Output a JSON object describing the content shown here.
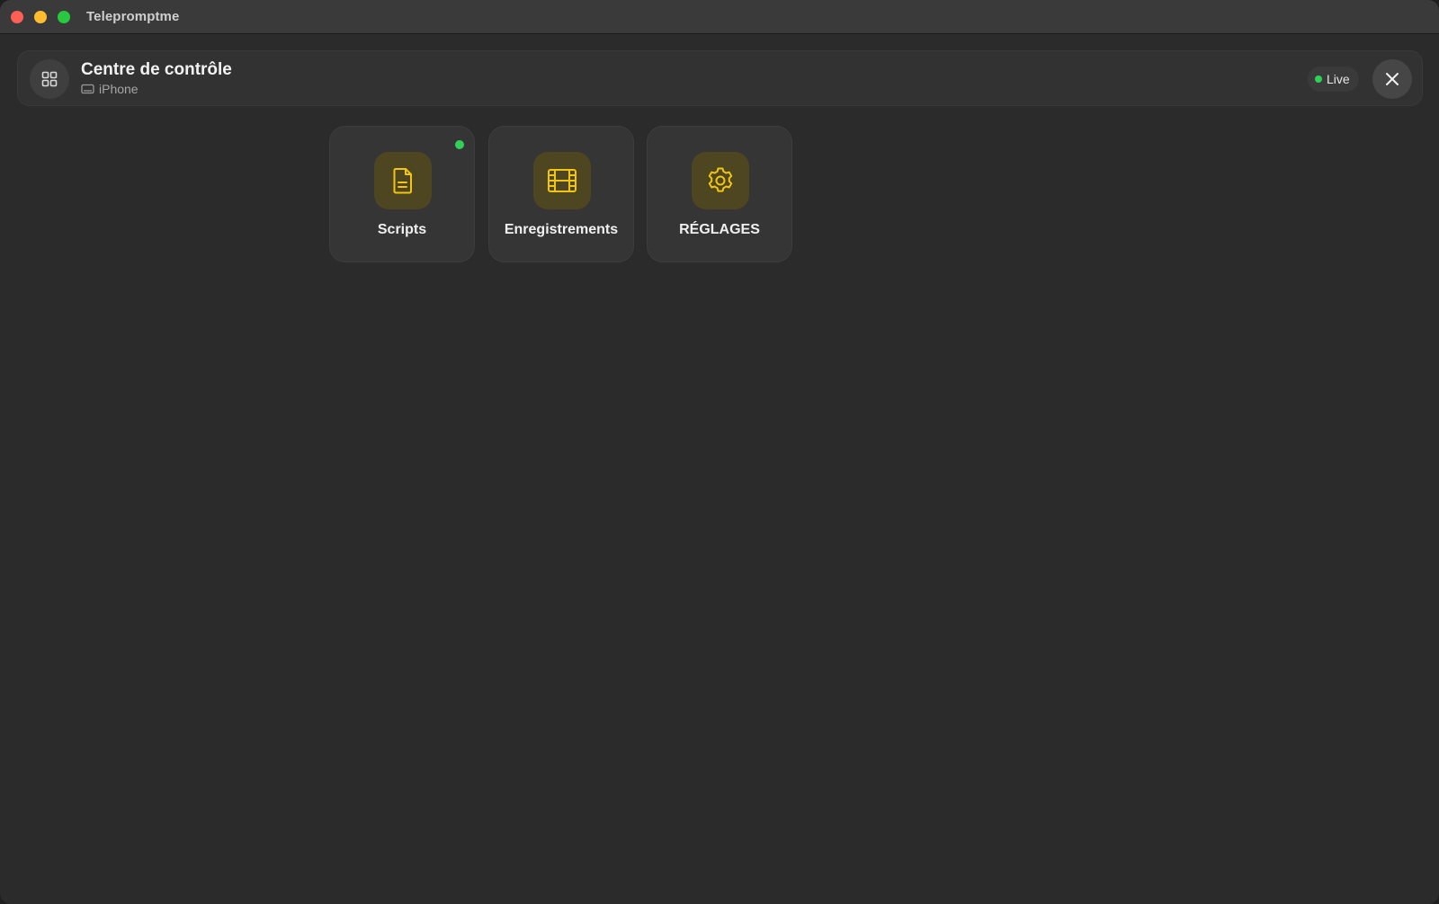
{
  "window": {
    "title": "Telepromptme",
    "controls": {
      "close_color": "#ff5f57",
      "minimize_color": "#febc2e",
      "maximize_color": "#28c840"
    }
  },
  "header": {
    "title": "Centre de contrôle",
    "device": "iPhone",
    "live_label": "Live",
    "live_color": "#30d158",
    "grid_icon": "grid-icon",
    "close_icon": "close-icon"
  },
  "tiles": [
    {
      "label": "Scripts",
      "icon": "document-icon",
      "has_indicator": true
    },
    {
      "label": "Enregistrements",
      "icon": "film-icon",
      "has_indicator": false
    },
    {
      "label": "RÉGLAGES",
      "icon": "gear-icon",
      "has_indicator": false
    }
  ],
  "colors": {
    "accent": "#f2c511",
    "indicator": "#30d158"
  }
}
